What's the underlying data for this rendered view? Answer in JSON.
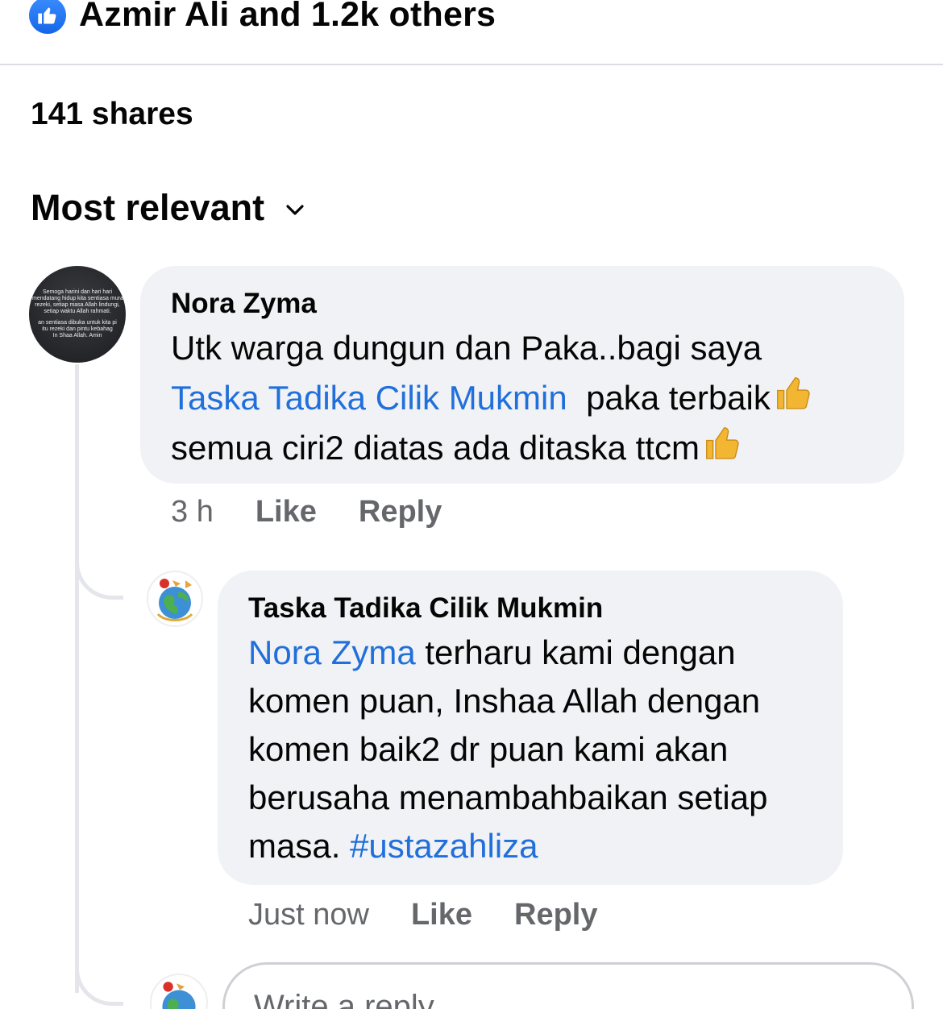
{
  "reactions": {
    "text": "Azmir Ali and 1.2k others",
    "icon": "like-icon",
    "color": "#1877f2"
  },
  "shares": "141 shares",
  "sort": {
    "label": "Most relevant",
    "icon": "chevron-down-icon"
  },
  "comments": [
    {
      "author": "Nora Zyma",
      "lines": {
        "l1": "Utk warga dungun dan Paka..bagi saya",
        "mention": "Taska Tadika Cilik Mukmin",
        "l2_rest": "paka terbaik",
        "l3": "semua ciri2 diatas ada ditaska ttcm"
      },
      "avatar_text": [
        "Semoga harini dan hari hari",
        "mendatang hidup kita sentiasa mura",
        "rezeki, setiap masa Allah lindungi,",
        "setiap waktu Allah rahmati.",
        "an sentiasa dibuka untuk kita pi",
        "itu rezeki dan pintu kebahag",
        "In Shaa Allah. Amin"
      ],
      "time": "3 h",
      "like": "Like",
      "reply": "Reply",
      "reply_item": {
        "author": "Taska Tadika Cilik Mukmin",
        "mention": "Nora Zyma",
        "l1_rest": "terharu kami dengan",
        "l2": "komen puan, Inshaa Allah dengan",
        "l3": "komen baik2 dr puan kami akan",
        "l4": "berusaha menambahbaikan setiap",
        "l5_start": "masa.",
        "hashtag": "#ustazahliza",
        "time": "Just now",
        "like": "Like",
        "reply": "Reply"
      }
    }
  ],
  "reply_input": {
    "placeholder": "Write a reply..."
  },
  "colors": {
    "link": "#216fdb",
    "bubble": "#f0f2f5",
    "muted": "#65676b"
  }
}
